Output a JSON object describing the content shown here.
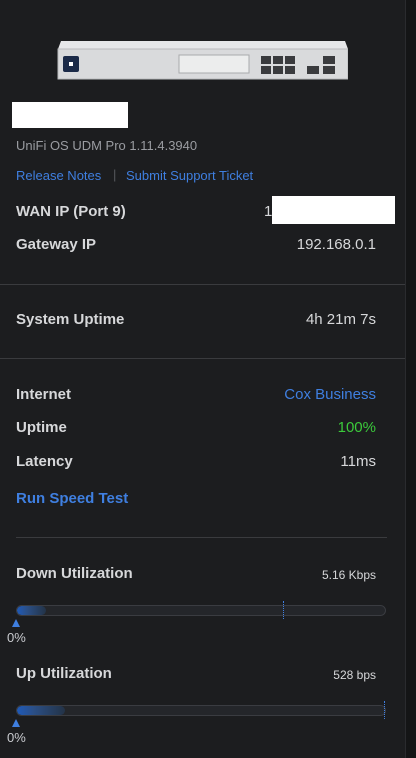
{
  "device": {
    "os_version": "UniFi OS UDM Pro 1.11.4.3940",
    "links": {
      "release_notes": "Release Notes",
      "separator": "|",
      "support_ticket": "Submit Support Ticket"
    }
  },
  "network": {
    "wan_ip_label": "WAN IP (Port 9)",
    "wan_ip_value_visible": "1",
    "gateway_ip_label": "Gateway IP",
    "gateway_ip_value": "192.168.0.1"
  },
  "system": {
    "uptime_label": "System Uptime",
    "uptime_value": "4h 21m 7s"
  },
  "internet": {
    "label": "Internet",
    "provider": "Cox Business",
    "uptime_label": "Uptime",
    "uptime_value": "100%",
    "latency_label": "Latency",
    "latency_value": "11ms",
    "speed_test_link": "Run Speed Test"
  },
  "utilization": {
    "down": {
      "label": "Down Utilization",
      "rate": "5.16 Kbps",
      "percent_label": "0%",
      "fill_fraction": 0.08
    },
    "up": {
      "label": "Up Utilization",
      "rate": "528 bps",
      "percent_label": "0%",
      "fill_fraction": 0.13
    }
  },
  "colors": {
    "accent": "#3f7fe0",
    "success": "#3bc93b",
    "background": "#1c1d1f"
  }
}
